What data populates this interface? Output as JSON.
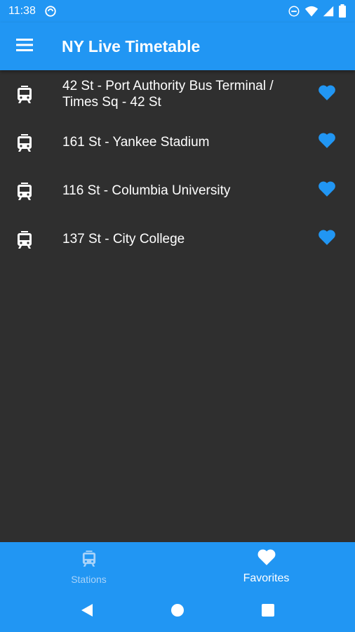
{
  "status_bar": {
    "time": "11:38"
  },
  "app_bar": {
    "title": "NY Live Timetable"
  },
  "stations": [
    {
      "name": "42 St - Port Authority Bus Terminal / Times Sq - 42 St"
    },
    {
      "name": "161 St - Yankee Stadium"
    },
    {
      "name": "116 St - Columbia University"
    },
    {
      "name": "137 St - City College"
    }
  ],
  "bottom_nav": {
    "stations_label": "Stations",
    "favorites_label": "Favorites"
  },
  "colors": {
    "primary": "#2196f3",
    "background": "#2f2f2f",
    "inactive_tab": "#a9d3f9"
  },
  "icons": {
    "station_icon": "tram-icon",
    "favorite_icon": "heart-icon"
  }
}
